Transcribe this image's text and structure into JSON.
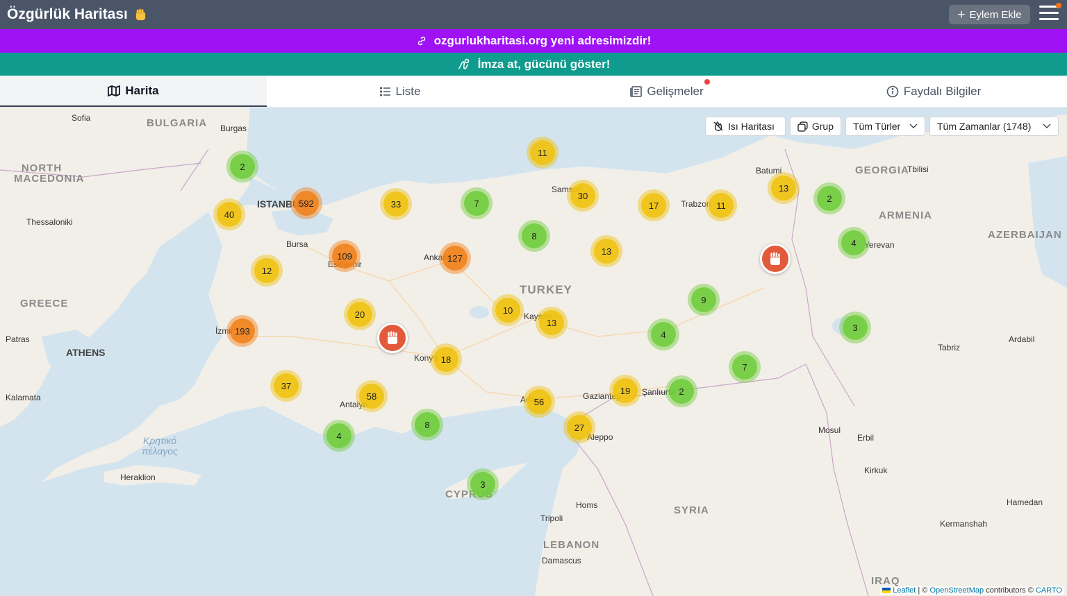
{
  "header": {
    "title": "Özgürlük Haritası",
    "add_button": "Eylem Ekle"
  },
  "banners": {
    "new_address": "ozgurlukharitasi.org yeni adresimizdir!",
    "petition": "İmza at, gücünü göster!"
  },
  "tabs": [
    {
      "label": "Harita",
      "icon": "map-icon",
      "active": true
    },
    {
      "label": "Liste",
      "icon": "list-icon",
      "active": false
    },
    {
      "label": "Gelişmeler",
      "icon": "news-icon",
      "active": false
    },
    {
      "label": "Faydalı Bilgiler",
      "icon": "info-icon",
      "active": false
    }
  ],
  "map_controls": {
    "heatmap": "Isı Haritası",
    "group": "Grup",
    "type_select": "Tüm Türler",
    "time_select": "Tüm Zamanlar (1748)"
  },
  "clusters": [
    "2",
    "40",
    "592",
    "33",
    "7",
    "11",
    "30",
    "17",
    "11",
    "13",
    "2",
    "8",
    "13",
    "109",
    "127",
    "12",
    "4",
    "20",
    "10",
    "13",
    "193",
    "9",
    "3",
    "4",
    "18",
    "7",
    "37",
    "58",
    "56",
    "19",
    "2",
    "8",
    "4",
    "27",
    "3"
  ],
  "map_labels": {
    "countries": [
      "BULGARIA",
      "NORTH MACEDONIA",
      "GREECE",
      "TURKEY",
      "GEORGIA",
      "ARMENIA",
      "AZERBAIJAN",
      "SYRIA",
      "LEBANON",
      "CYPRUS",
      "IRAQ"
    ],
    "cities": [
      "Sofia",
      "Burgas",
      "Thessaloniki",
      "ISTANBUL",
      "Bursa",
      "Eskişehir",
      "Ankara",
      "Samsun",
      "Trabzon",
      "Batumi",
      "Tbilisi",
      "Yerevan",
      "Kayseri",
      "İzmir",
      "Patras",
      "ATHENS",
      "Konya",
      "Antalya",
      "Adana",
      "Gaziantep",
      "Şanlıurfa",
      "Kalamata",
      "Heraklion",
      "Aleppo",
      "Homs",
      "Tripoli",
      "Damascus",
      "Mosul",
      "Erbil",
      "Kirkuk",
      "Tabriz",
      "Ardabil",
      "Hamedan",
      "Kermanshah"
    ],
    "sea": "Κρητικό πέλαγος"
  },
  "attribution": {
    "leaflet": "Leaflet",
    "osm": "OpenStreetMap",
    "contributors": "contributors ©",
    "carto": "CARTO"
  }
}
